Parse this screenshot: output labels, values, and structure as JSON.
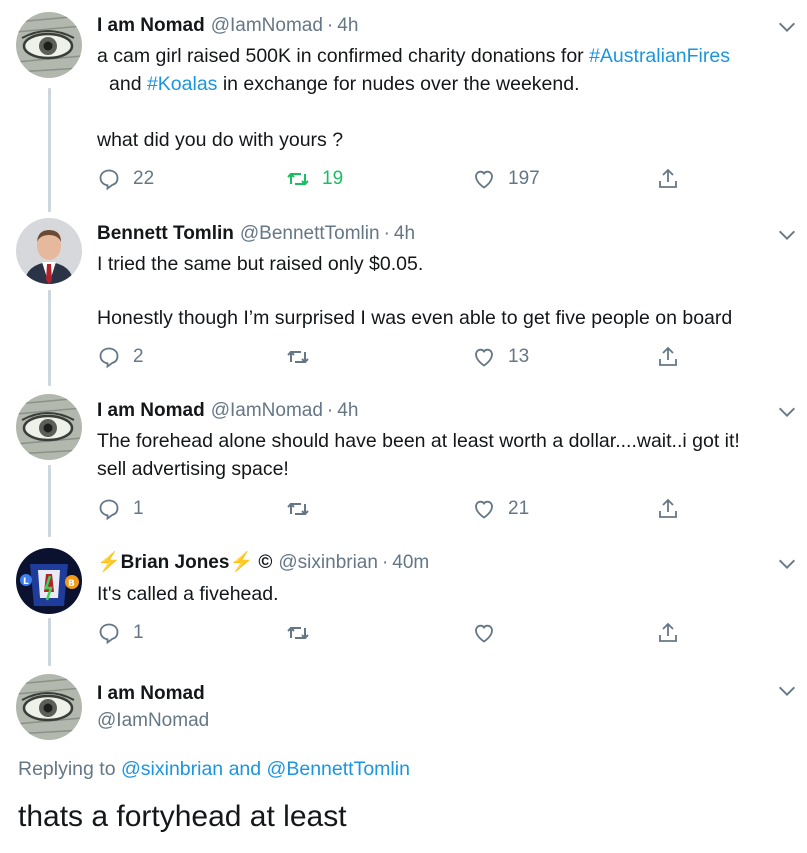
{
  "tweets": [
    {
      "name": "I am Nomad",
      "handle": "@IamNomad",
      "dot": "·",
      "time": "4h",
      "line1_a": "a cam girl raised 500K in confirmed charity donations for ",
      "line1_tag": "#AustralianFires",
      "line2_a": "and ",
      "line2_tag": "#Koalas",
      "line2_b": " in exchange for nudes over the weekend.",
      "line3": "what did you do with yours ?",
      "reply_count": "22",
      "retweet_count": "19",
      "like_count": "197"
    },
    {
      "name": "Bennett Tomlin",
      "handle": "@BennettTomlin",
      "dot": "·",
      "time": "4h",
      "line1": "I tried the same but raised only $0.05.",
      "line2": "Honestly though I’m surprised I was even able to get five people on board",
      "reply_count": "2",
      "retweet_count": "",
      "like_count": "13"
    },
    {
      "name": "I am Nomad",
      "handle": "@IamNomad",
      "dot": "·",
      "time": "4h",
      "line1": "The forehead alone should have been at least worth a dollar....wait..i got it!",
      "line2": "sell advertising space!",
      "reply_count": "1",
      "retweet_count": "",
      "like_count": "21"
    },
    {
      "name_prefix": "⚡",
      "name": "Brian Jones",
      "name_suffix": "⚡",
      "name_mark": "©",
      "handle": "@sixinbrian",
      "dot": "·",
      "time": "40m",
      "line1": "It's called a fivehead.",
      "reply_count": "1",
      "retweet_count": "",
      "like_count": ""
    }
  ],
  "main_tweet": {
    "name": "I am Nomad",
    "handle": "@IamNomad",
    "replying_to_prefix": "Replying to",
    "mention1": "@sixinbrian",
    "and_word": "and",
    "mention2": "@BennettTomlin",
    "text": "thats a fortyhead at least"
  },
  "colors": {
    "link": "#1b95e0",
    "retweet_active": "#17bf63",
    "secondary_text": "#657786",
    "thread_line": "#ccd6dd"
  },
  "icons": [
    "reply-icon",
    "retweet-icon",
    "like-icon",
    "share-icon",
    "chevron-down-icon"
  ]
}
